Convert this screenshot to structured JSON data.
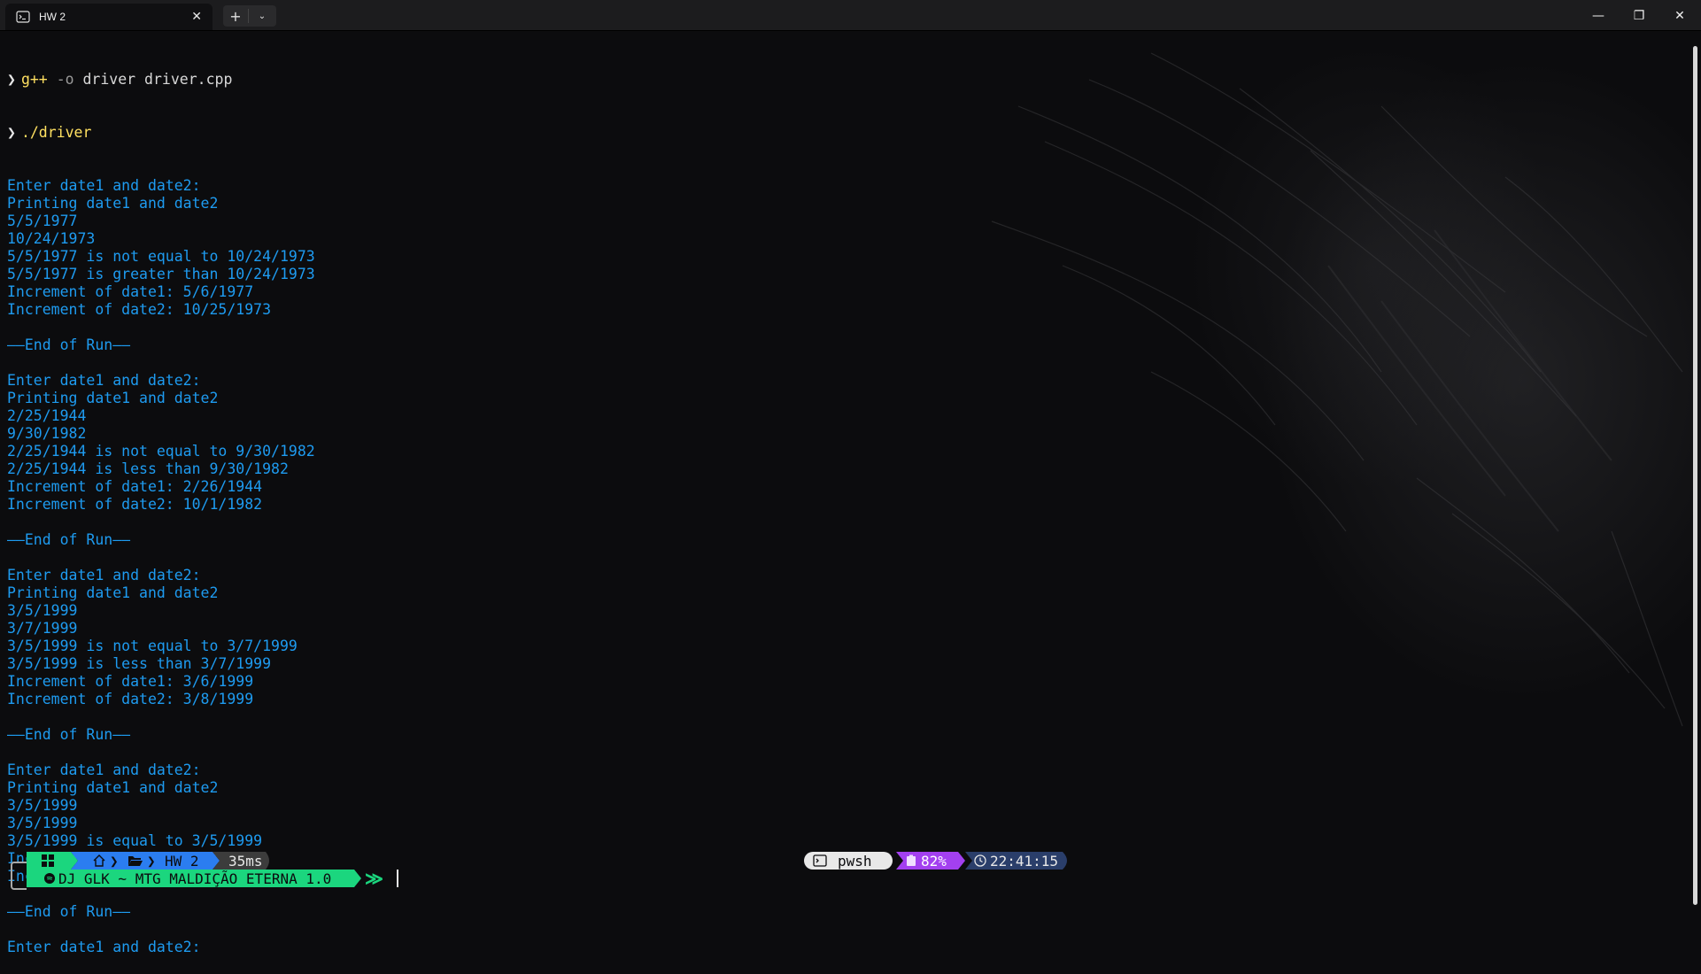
{
  "window": {
    "tab_title": "HW 2",
    "tab_close": "✕",
    "new_tab": "+",
    "dropdown": "⌄",
    "minimize": "—",
    "maximize": "❐",
    "close": "✕"
  },
  "terminal": {
    "commands": [
      {
        "prefix": "g++",
        "flag": "-o",
        "rest": "driver driver.cpp"
      },
      {
        "prefix": "./driver",
        "flag": "",
        "rest": ""
      }
    ],
    "output_lines": [
      "Enter date1 and date2:",
      "Printing date1 and date2",
      "5/5/1977",
      "10/24/1973",
      "5/5/1977 is not equal to 10/24/1973",
      "5/5/1977 is greater than 10/24/1973",
      "Increment of date1: 5/6/1977",
      "Increment of date2: 10/25/1973",
      "",
      "——End of Run——",
      "",
      "Enter date1 and date2:",
      "Printing date1 and date2",
      "2/25/1944",
      "9/30/1982",
      "2/25/1944 is not equal to 9/30/1982",
      "2/25/1944 is less than 9/30/1982",
      "Increment of date1: 2/26/1944",
      "Increment of date2: 10/1/1982",
      "",
      "——End of Run——",
      "",
      "Enter date1 and date2:",
      "Printing date1 and date2",
      "3/5/1999",
      "3/7/1999",
      "3/5/1999 is not equal to 3/7/1999",
      "3/5/1999 is less than 3/7/1999",
      "Increment of date1: 3/6/1999",
      "Increment of date2: 3/8/1999",
      "",
      "——End of Run——",
      "",
      "Enter date1 and date2:",
      "Printing date1 and date2",
      "3/5/1999",
      "3/5/1999",
      "3/5/1999 is equal to 3/5/1999",
      "Increment of date1: 3/6/1999",
      "Increment of date2: 3/6/1999",
      "",
      "——End of Run——",
      "",
      "Enter date1 and date2:"
    ]
  },
  "prompt": {
    "folder": "HW 2",
    "duration": "35ms",
    "music": "DJ GLK ~ MTG MALDIÇÃO ETERNA 1.0",
    "prompt_symbol": "≫",
    "shell": "pwsh",
    "battery": "82%",
    "time": "22:41:15"
  },
  "colors": {
    "command_yellow": "#ffe061",
    "output_blue": "#1e9bf0",
    "segment_green": "#1bd67e",
    "segment_blue": "#2b7df0",
    "segment_gray": "#3c3c3c",
    "segment_purple": "#a340f0",
    "segment_navy": "#2a3e6a"
  },
  "icons": [
    "terminal-tab-icon",
    "windows-logo-icon",
    "home-icon",
    "folder-open-icon",
    "spotify-icon",
    "console-icon",
    "battery-icon",
    "clock-icon"
  ]
}
